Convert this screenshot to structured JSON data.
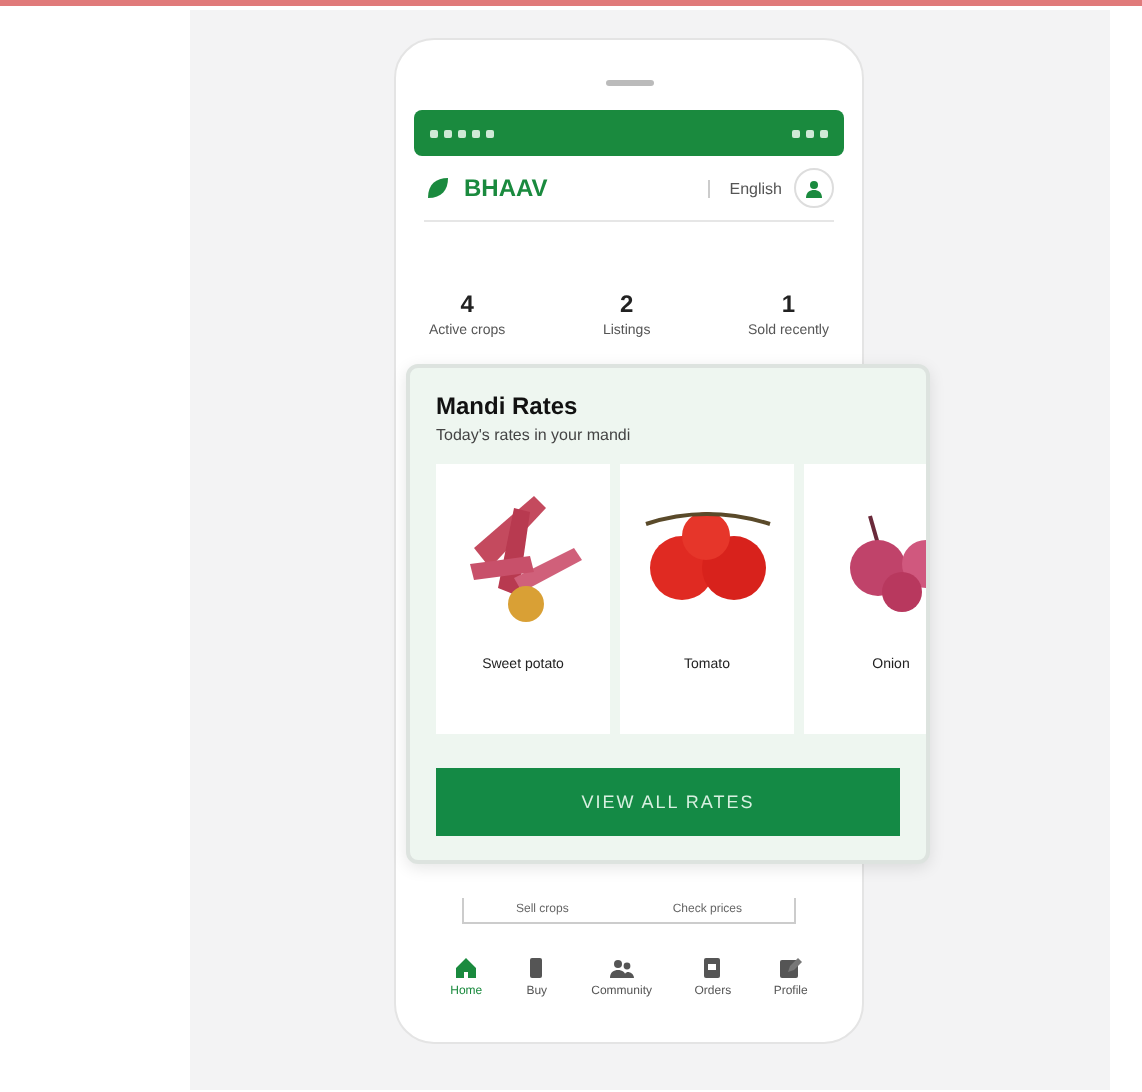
{
  "app": {
    "logo": "BHAAV",
    "language": "English"
  },
  "stats": [
    {
      "value": "4",
      "label": "Active crops"
    },
    {
      "value": "2",
      "label": "Listings"
    },
    {
      "value": "1",
      "label": "Sold recently"
    }
  ],
  "rates_popup": {
    "title": "Mandi Rates",
    "subtitle": "Today's rates in your mandi",
    "items": [
      {
        "name": "Sweet potato",
        "kind": "sweet-potato"
      },
      {
        "name": "Tomato",
        "kind": "tomato"
      },
      {
        "name": "Onion",
        "kind": "onion"
      }
    ],
    "button": "VIEW ALL RATES"
  },
  "actions": [
    "Sell crops",
    "Check prices"
  ],
  "bottom_nav": [
    {
      "label": "Home",
      "kind": "home",
      "selected": true
    },
    {
      "label": "Buy",
      "kind": "phone",
      "selected": false
    },
    {
      "label": "Community",
      "kind": "people",
      "selected": false
    },
    {
      "label": "Orders",
      "kind": "box",
      "selected": false
    },
    {
      "label": "Profile",
      "kind": "edit",
      "selected": false
    }
  ]
}
